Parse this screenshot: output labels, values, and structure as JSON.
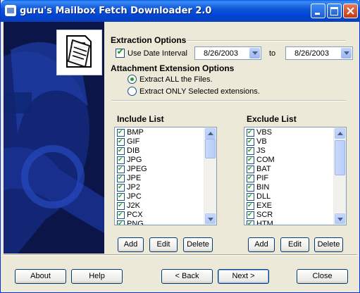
{
  "window": {
    "title": "guru's Mailbox Fetch Downloader  2.0"
  },
  "extraction": {
    "heading": "Extraction Options",
    "use_date_interval_label": "Use Date Interval",
    "use_date_interval_checked": true,
    "date_from": "8/26/2003",
    "to_label": "to",
    "date_to": "8/26/2003"
  },
  "attachment": {
    "heading": "Attachment Extension Options",
    "extract_all_label": "Extract ALL the Files.",
    "extract_selected_label": "Extract ONLY Selected extensions.",
    "selected_option": "extract_all"
  },
  "include_list": {
    "heading": "Include List",
    "items": [
      "BMP",
      "GIF",
      "DIB",
      "JPG",
      "JPEG",
      "JPE",
      "JP2",
      "JPC",
      "J2K",
      "PCX",
      "PNG"
    ],
    "add_label": "Add",
    "edit_label": "Edit",
    "delete_label": "Delete"
  },
  "exclude_list": {
    "heading": "Exclude List",
    "items": [
      "VBS",
      "VB",
      "JS",
      "COM",
      "BAT",
      "PIF",
      "BIN",
      "DLL",
      "EXE",
      "SCR",
      "HTM"
    ],
    "add_label": "Add",
    "edit_label": "Edit",
    "delete_label": "Delete"
  },
  "footer": {
    "about_label": "About",
    "help_label": "Help",
    "back_label": "< Back",
    "next_label": "Next >",
    "close_label": "Close"
  },
  "colors": {
    "titlebar": "#0046D5",
    "dialog_bg": "#ECE9D8",
    "banner_bg": "#0c1a4a",
    "check_green": "#21A121"
  },
  "icons": [
    "app-icon",
    "minimize-icon",
    "maximize-icon",
    "close-icon",
    "document-icon",
    "checkmark-icon",
    "chevron-down-icon"
  ]
}
